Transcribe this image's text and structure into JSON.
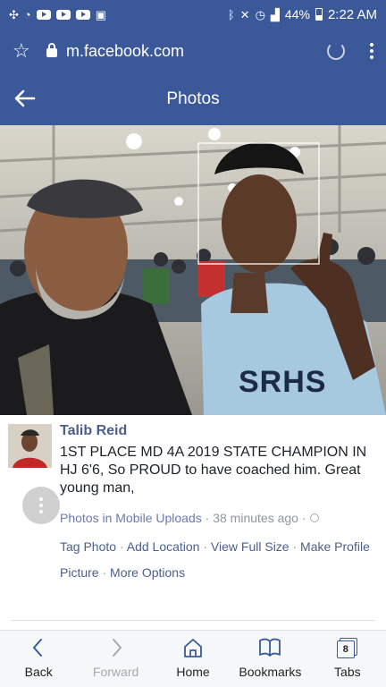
{
  "status_bar": {
    "battery": "44%",
    "time": "2:22 AM"
  },
  "browser": {
    "url": "m.facebook.com"
  },
  "header": {
    "title": "Photos"
  },
  "post": {
    "author": "Talib Reid",
    "text": "1ST PLACE MD 4A 2019 STATE CHAMPION IN HJ 6'6, So PROUD to have coached him. Great young man,",
    "album": "Photos in Mobile Uploads",
    "time": "38 minutes ago",
    "photo_text": "SRHS",
    "actions": {
      "tag_photo": "Tag Photo",
      "add_location": "Add Location",
      "view_full_size": "View Full Size",
      "make_profile_picture": "Make Profile Picture",
      "more_options": "More Options"
    }
  },
  "bottom_nav": {
    "back": "Back",
    "forward": "Forward",
    "home": "Home",
    "bookmarks": "Bookmarks",
    "tabs": "Tabs",
    "tabs_count": "8"
  },
  "colors": {
    "facebook_blue": "#3b5998",
    "link": "#4b5f8c",
    "meta_gray": "#90949c"
  }
}
